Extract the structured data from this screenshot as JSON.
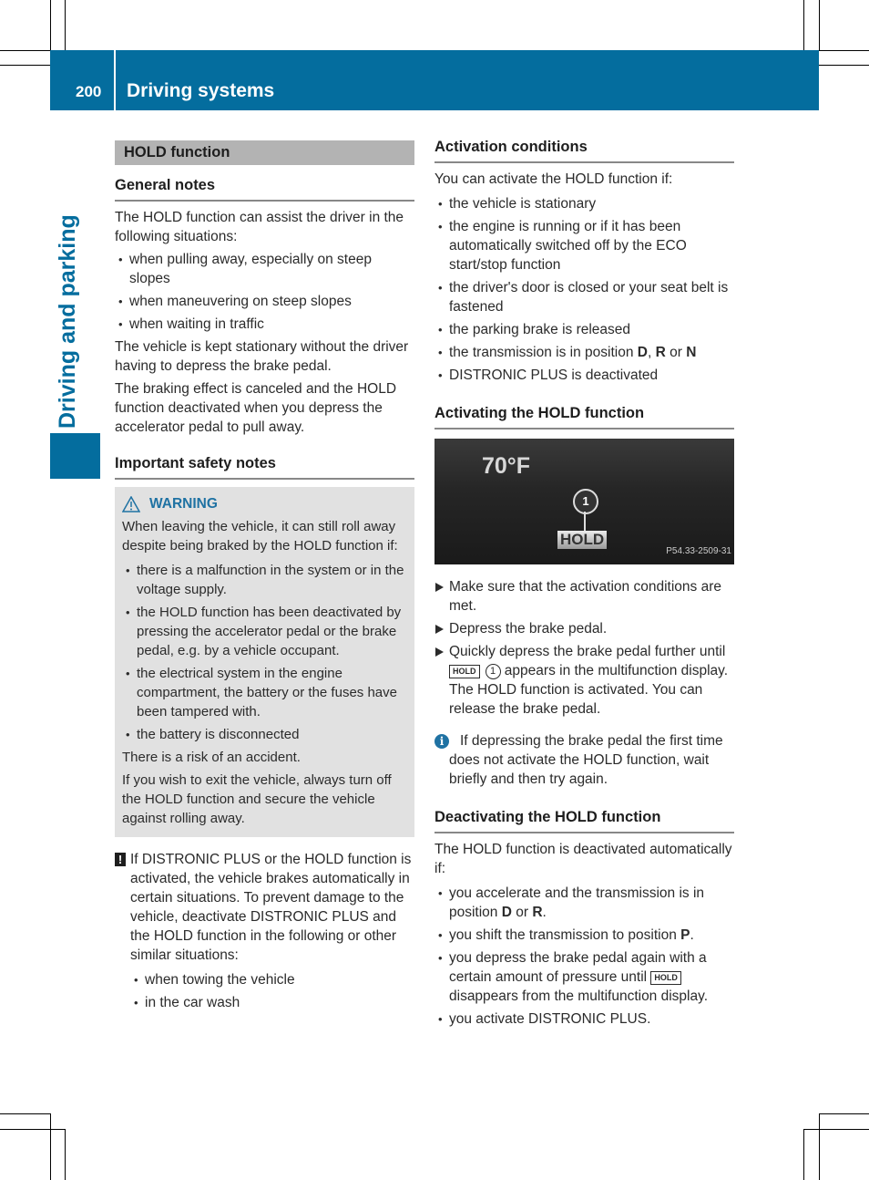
{
  "header": {
    "page_number": "200",
    "title": "Driving systems",
    "side_tab": "Driving and parking",
    "brand_color": "#046d9e"
  },
  "left": {
    "section_title": "HOLD function",
    "general_notes": {
      "heading": "General notes",
      "intro": "The HOLD function can assist the driver in the following situations:",
      "bullets": [
        "when pulling away, especially on steep slopes",
        "when maneuvering on steep slopes",
        "when waiting in traffic"
      ],
      "para1": "The vehicle is kept stationary without the driver having to depress the brake pedal.",
      "para2": "The braking effect is canceled and the HOLD function deactivated when you depress the accelerator pedal to pull away."
    },
    "safety": {
      "heading": "Important safety notes",
      "warning_label": "WARNING",
      "warning_icon": "warning-triangle-icon",
      "warning_intro": "When leaving the vehicle, it can still roll away despite being braked by the HOLD function if:",
      "warning_bullets": [
        "there is a malfunction in the system or in the voltage supply.",
        "the HOLD function has been deactivated by pressing the accelerator pedal or the brake pedal, e.g. by a vehicle occupant.",
        "the electrical system in the engine compartment, the battery or the fuses have been tampered with.",
        "the battery is disconnected"
      ],
      "risk": "There is a risk of an accident.",
      "advice": "If you wish to exit the vehicle, always turn off the HOLD function and secure the vehicle against rolling away."
    },
    "notice": {
      "icon": "exclamation-icon",
      "mark": "!",
      "text": "If DISTRONIC PLUS or the HOLD function is activated, the vehicle brakes automatically in certain situations. To prevent damage to the vehicle, deactivate DISTRONIC PLUS and the HOLD function in the following or other similar situations:",
      "bullets": [
        "when towing the vehicle",
        "in the car wash"
      ]
    }
  },
  "right": {
    "activation_conditions": {
      "heading": "Activation conditions",
      "intro": "You can activate the HOLD function if:",
      "bullets": [
        "the vehicle is stationary",
        "the engine is running or if it has been automatically switched off by the ECO start/stop function",
        "the driver's door is closed or your seat belt is fastened",
        "the parking brake is released"
      ],
      "transmission_prefix": "the transmission is in position ",
      "gear_d": "D",
      "comma": ", ",
      "gear_r": "R",
      "or": " or ",
      "gear_n": "N",
      "last_bullet": "DISTRONIC PLUS is deactivated"
    },
    "activating": {
      "heading": "Activating the HOLD function",
      "display": {
        "temperature": "70°F",
        "callout": "1",
        "indicator": "HOLD",
        "image_code": "P54.33-2509-31"
      },
      "step1": "Make sure that the activation conditions are met.",
      "step2": "Depress the brake pedal.",
      "step3_prefix": "Quickly depress the brake pedal further until ",
      "step3_badge": "HOLD",
      "step3_callout": "1",
      "step3_suffix": " appears in the multifunction display.",
      "step3_result": "The HOLD function is activated. You can release the brake pedal.",
      "info_icon": "info-icon",
      "info_text": "If depressing the brake pedal the first time does not activate the HOLD function, wait briefly and then try again."
    },
    "deactivating": {
      "heading": "Deactivating the HOLD function",
      "intro": "The HOLD function is deactivated automatically if:",
      "b1_prefix": "you accelerate and the transmission is in position ",
      "b1_d": "D",
      "b1_or": " or ",
      "b1_r": "R",
      "b1_end": ".",
      "b2_prefix": "you shift the transmission to position ",
      "b2_p": "P",
      "b2_end": ".",
      "b3_prefix": "you depress the brake pedal again with a certain amount of pressure until ",
      "b3_badge": "HOLD",
      "b3_suffix": " disappears from the multifunction display.",
      "b4": "you activate DISTRONIC PLUS."
    }
  }
}
